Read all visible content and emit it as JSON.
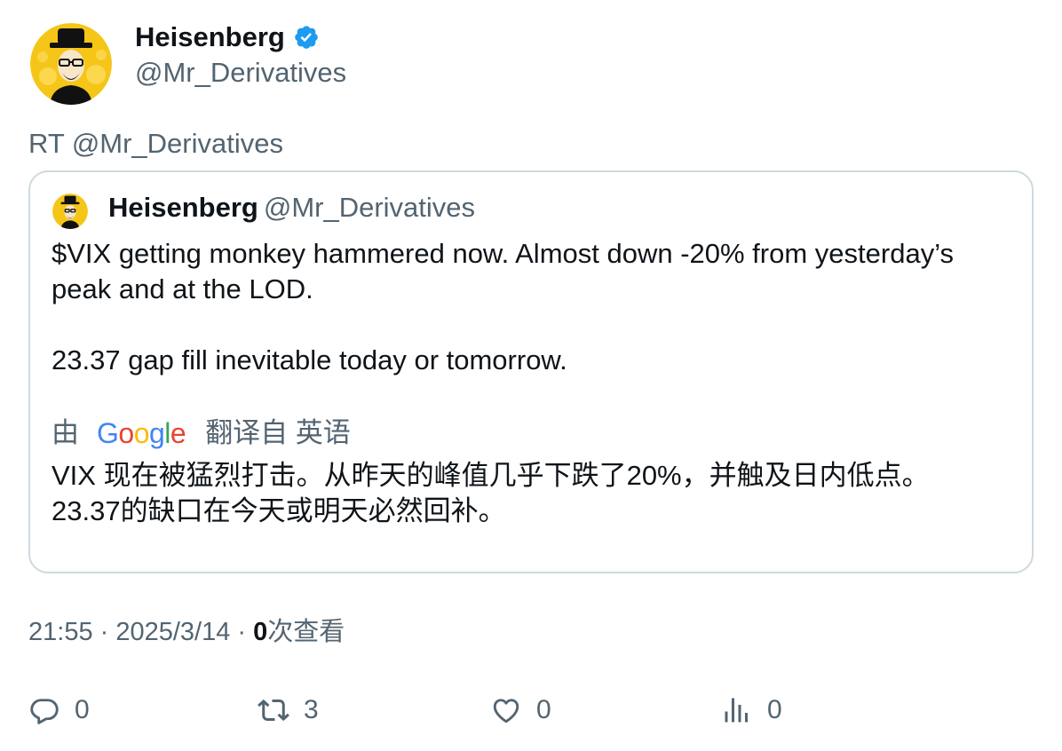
{
  "author": {
    "display_name": "Heisenberg",
    "handle": "@Mr_Derivatives",
    "verified": true
  },
  "retweet_line": "RT @Mr_Derivatives",
  "quoted_tweet": {
    "display_name": "Heisenberg",
    "handle": "@Mr_Derivatives",
    "text_line1": "$VIX getting monkey hammered now. Almost down -20% from yesterday’s peak and at the LOD.",
    "text_line2": "23.37 gap fill inevitable today or tomorrow.",
    "translation": {
      "by_prefix": "由",
      "provider": "Google",
      "suffix": "翻译自 英语",
      "line1": "VIX 现在被猛烈打击。从昨天的峰值几乎下跌了20%，并触及日内低点。",
      "line2": "23.37的缺口在今天或明天必然回补。"
    }
  },
  "meta": {
    "time": "21:55",
    "separator": " · ",
    "date": "2025/3/14",
    "views_count": "0",
    "views_label": "次查看"
  },
  "actions": {
    "reply_count": "0",
    "retweet_count": "3",
    "like_count": "0",
    "views_count": "0"
  },
  "colors": {
    "verified_blue": "#1d9bf0",
    "secondary_text": "#536471",
    "border": "#cfd9de",
    "avatar_yellow": "#f5c518"
  },
  "icons": {
    "reply": "reply-bubble-icon",
    "retweet": "retweet-arrows-icon",
    "like": "heart-icon",
    "views": "bar-chart-icon",
    "verified": "verified-badge-icon"
  }
}
